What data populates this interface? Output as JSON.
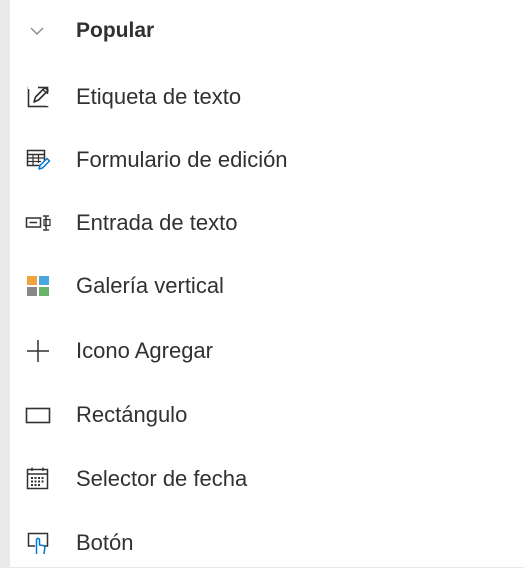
{
  "section": {
    "title": "Popular",
    "expanded": true,
    "icon": "chevron-down-icon"
  },
  "items": [
    {
      "label": "Etiqueta de texto",
      "icon": "edit-pencil-icon"
    },
    {
      "label": "Formulario de edición",
      "icon": "edit-form-icon"
    },
    {
      "label": "Entrada de texto",
      "icon": "text-input-icon"
    },
    {
      "label": "Galería vertical",
      "icon": "vertical-gallery-icon"
    },
    {
      "label": "Icono Agregar",
      "icon": "add-plus-icon"
    },
    {
      "label": "Rectángulo",
      "icon": "rectangle-icon"
    },
    {
      "label": "Selector de fecha",
      "icon": "calendar-icon"
    },
    {
      "label": "Botón",
      "icon": "button-touch-icon"
    }
  ],
  "colors": {
    "text": "#323130",
    "icon": "#323130",
    "accent": "#0078d4",
    "gallery_orange": "#f0a23c",
    "gallery_blue": "#4aa6df",
    "gallery_green": "#69b36a",
    "gallery_gray": "#8a8886",
    "background": "#ffffff",
    "side_gutter": "#e9e9e9"
  }
}
